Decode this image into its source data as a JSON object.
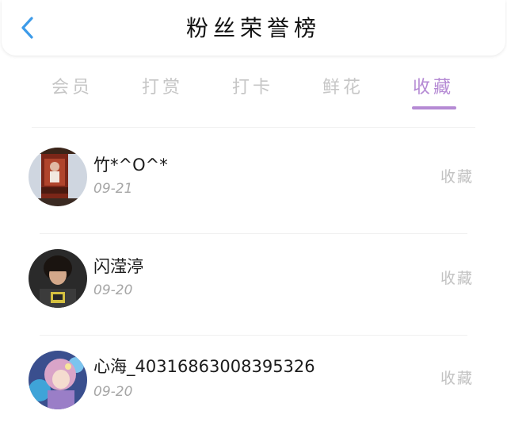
{
  "header": {
    "title": "粉丝荣誉榜",
    "back_icon": "chevron-left-icon",
    "accent_color": "#3d9be9"
  },
  "tabs": [
    {
      "label": "会员",
      "active": false
    },
    {
      "label": "打赏",
      "active": false
    },
    {
      "label": "打卡",
      "active": false
    },
    {
      "label": "鲜花",
      "active": false
    },
    {
      "label": "收藏",
      "active": true
    }
  ],
  "active_tab_color": "#b58ad4",
  "fans": [
    {
      "name": "竹*^O^*",
      "date": "09-21",
      "action": "收藏"
    },
    {
      "name": "闪滢渟",
      "date": "09-20",
      "action": "收藏"
    },
    {
      "name": "心海_40316863008395326",
      "date": "09-20",
      "action": "收藏"
    }
  ]
}
